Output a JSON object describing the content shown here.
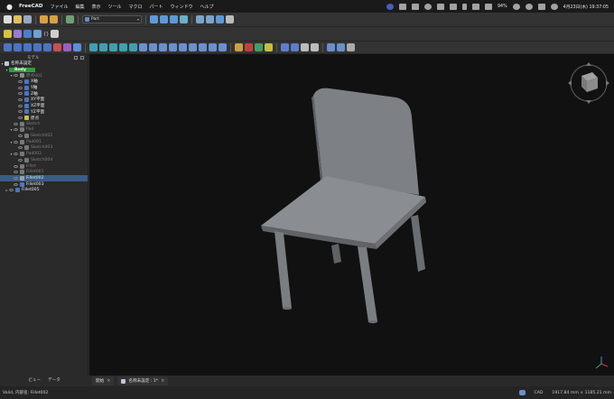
{
  "menubar": {
    "app_name": "FreeCAD",
    "items": [
      "ファイル",
      "編集",
      "表示",
      "ツール",
      "マクロ",
      "パート",
      "ウィンドウ",
      "ヘルプ"
    ],
    "battery": "94%",
    "datetime": "4月23日(木) 19:37:05"
  },
  "toolbar": {
    "workbench": "Part"
  },
  "panel": {
    "title": "モデル",
    "tabs": [
      "ビュー",
      "データ"
    ]
  },
  "tree": {
    "root": "名称未設定",
    "body": "Body",
    "origin": "原点001",
    "origin_items": [
      "X軸",
      "Y軸",
      "Z軸",
      "XY平面",
      "XZ平面",
      "YZ平面",
      "原点"
    ],
    "sketch": "Sketch",
    "pad": "Pad",
    "sketch002": "Sketch002",
    "pad001": "Pad001",
    "sketch003": "Sketch003",
    "pad002": "Pad002",
    "sketch004": "Sketch004",
    "fillet": "Fillet",
    "fillet001": "Fillet001",
    "fillet002": "Fillet002",
    "fillet003": "Fillet003",
    "fillet005": "Fillet005"
  },
  "doctabs": {
    "start": "開始",
    "document": "名称未設定 : 1*"
  },
  "status": {
    "message": "Valid, 内部名: Fillet002",
    "nav_style": "CAD",
    "dimensions": "1917.84 mm × 1185.21 mm"
  },
  "colors": {
    "selection": "#3a5c86",
    "body_highlight": "#2e9e3a",
    "chair": "#8a8d91"
  }
}
